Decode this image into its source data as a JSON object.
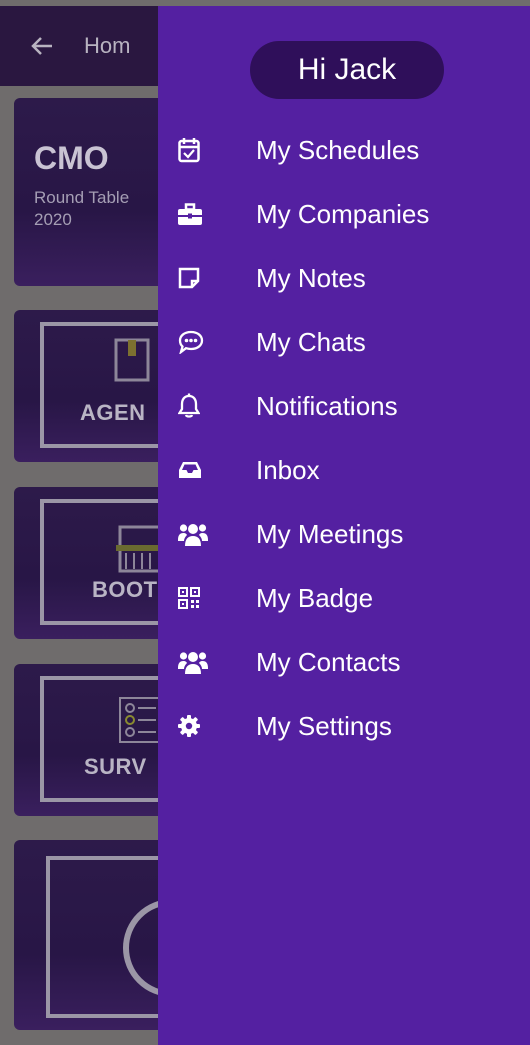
{
  "background": {
    "appbar": {
      "title": "Hom",
      "back_icon": "arrow-left-icon"
    },
    "event_card": {
      "code": "CMO",
      "subtitle_line1": "Round Table",
      "subtitle_line2": "2020"
    },
    "tiles": [
      {
        "label": "AGEN",
        "icon": "book-icon"
      },
      {
        "label": "BOOT",
        "icon": "booth-icon"
      },
      {
        "label": "SURV",
        "icon": "survey-icon"
      },
      {
        "label": "",
        "icon": "circle-icon"
      }
    ]
  },
  "drawer": {
    "greeting": "Hi Jack",
    "items": [
      {
        "label": "My Schedules",
        "icon": "calendar-check-icon"
      },
      {
        "label": "My Companies",
        "icon": "briefcase-icon"
      },
      {
        "label": "My Notes",
        "icon": "sticky-note-icon"
      },
      {
        "label": "My Chats",
        "icon": "chat-bubble-icon"
      },
      {
        "label": "Notifications",
        "icon": "bell-icon"
      },
      {
        "label": "Inbox",
        "icon": "inbox-icon"
      },
      {
        "label": "My Meetings",
        "icon": "users-icon"
      },
      {
        "label": "My Badge",
        "icon": "qr-code-icon"
      },
      {
        "label": "My Contacts",
        "icon": "users-icon"
      },
      {
        "label": "My Settings",
        "icon": "gear-icon"
      }
    ]
  },
  "colors": {
    "drawer_bg": "#5420a1",
    "greeting_bg": "#2f0f5a",
    "scrim": "#6f6c6c"
  }
}
